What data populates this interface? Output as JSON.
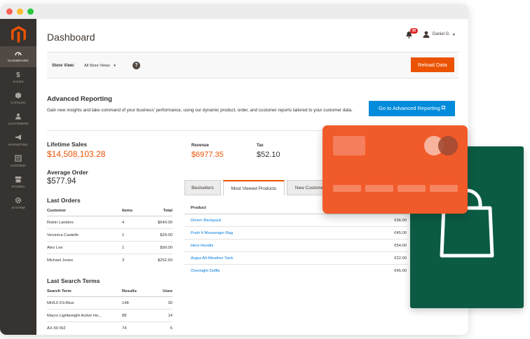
{
  "sidebar": {
    "items": [
      {
        "label": "DASHBOARD",
        "icon": "dashboard-icon"
      },
      {
        "label": "SALES",
        "icon": "dollar-icon"
      },
      {
        "label": "CATALOG",
        "icon": "box-icon"
      },
      {
        "label": "CUSTOMERS",
        "icon": "users-icon"
      },
      {
        "label": "MARKETING",
        "icon": "megaphone-icon"
      },
      {
        "label": "CONTENT",
        "icon": "content-icon"
      },
      {
        "label": "STORES",
        "icon": "store-icon"
      },
      {
        "label": "SYSTEM",
        "icon": "gear-icon"
      }
    ]
  },
  "header": {
    "title": "Dashboard",
    "notification_count": "35",
    "user_name": "Daniel G."
  },
  "store_bar": {
    "label": "Store View:",
    "value": "All Store Views",
    "help": "?",
    "reload_label": "Reload Data"
  },
  "advanced_reporting": {
    "title": "Advanced Reporting",
    "text": "Gain new insights and take command of your business' performance, using our dynamic product, order, and customer reports tailored to your customer data.",
    "button_label": "Go to Advanced Reporting"
  },
  "stats": {
    "lifetime_sales_label": "Lifetime Sales",
    "lifetime_sales_value": "$14,508,103.28",
    "avg_order_label": "Average Order",
    "avg_order_value": "$577.94",
    "revenue_label": "Revenue",
    "revenue_value": "$6977.35",
    "tax_label": "Tax",
    "tax_value": "$52.10"
  },
  "last_orders": {
    "title": "Last Orders",
    "headers": [
      "Customer",
      "Items",
      "Total"
    ],
    "rows": [
      [
        "Robin Landers",
        "4",
        "$640.00"
      ],
      [
        "Veronica Castello",
        "1",
        "$29.00"
      ],
      [
        "Alex Lee",
        "1",
        "$90.00"
      ],
      [
        "Michael Jones",
        "3",
        "$252.50"
      ]
    ]
  },
  "last_search_terms": {
    "title": "Last Search Terms",
    "headers": [
      "Search Term",
      "Results",
      "Uses"
    ],
    "rows": [
      [
        "MH13-XS-Blue",
        "148",
        "30"
      ],
      [
        "Macro Lightweight Active Ho...",
        "88",
        "14"
      ],
      [
        "AX-50 WZ",
        "74",
        "5"
      ]
    ]
  },
  "tabs": [
    "Bestsellers",
    "Most Viewed Products",
    "New Customers"
  ],
  "products": {
    "header": "Product",
    "rows": [
      [
        "Driven Backpack",
        "€36.00"
      ],
      [
        "Push It Messenger Bag",
        "€45.00"
      ],
      [
        "Hero Hoodie",
        "€54.00"
      ],
      [
        "Argus All-Weather Tank",
        "€22.00"
      ],
      [
        "Overnight Duffle",
        "€45.00"
      ]
    ]
  },
  "colors": {
    "brand_orange": "#eb5202",
    "sidebar": "#373330",
    "link_blue": "#007bdb",
    "card_orange": "#f15a29",
    "bag_green": "#0b5b44"
  }
}
